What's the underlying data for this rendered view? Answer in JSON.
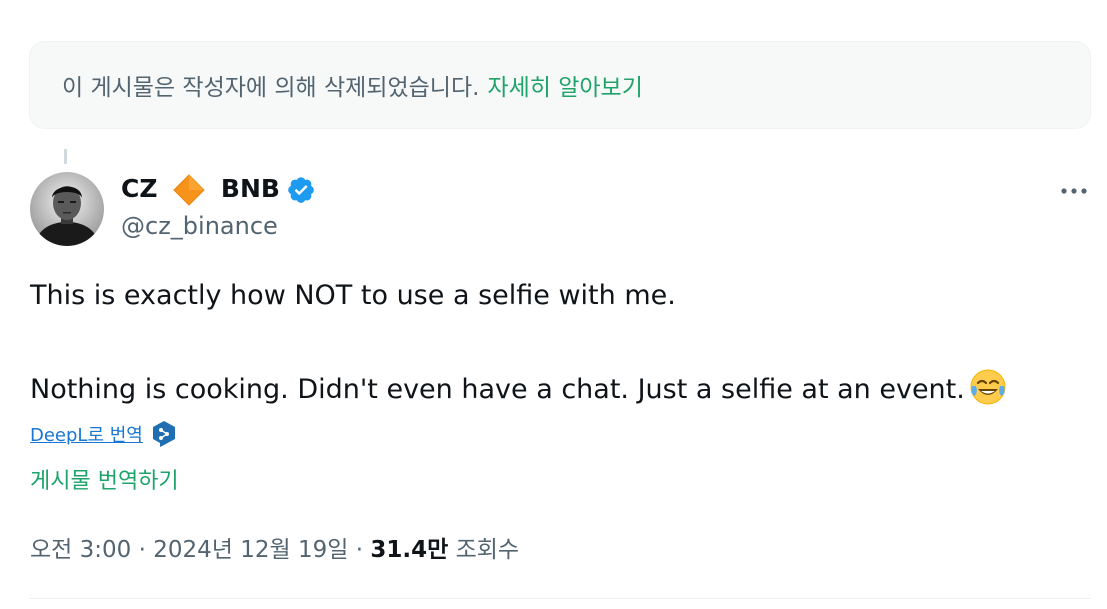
{
  "notice": {
    "text": "이 게시물은 작성자에 의해 삭제되었습니다.",
    "link": "자세히 알아보기"
  },
  "author": {
    "name_part1": "CZ",
    "name_part2": "BNB",
    "handle": "@cz_binance",
    "diamond_icon": "orange-diamond-icon",
    "verified_icon": "verified-badge-icon",
    "verified_color": "#1d9bf0",
    "diamond_color": "#f7931a"
  },
  "tweet": {
    "line1": "This is exactly how NOT to use a selfie with me.",
    "line2": "Nothing is cooking. Didn't even have a chat. Just a selfie at an event.",
    "emoji": "face-with-tears-of-joy-emoji"
  },
  "deepl": {
    "label": "DeepL로 번역",
    "icon": "deepl-icon"
  },
  "translate_link": "게시물 번역하기",
  "meta": {
    "time": "오전 3:00",
    "separator": "·",
    "date": "2024년 12월 19일",
    "views_count": "31.4만",
    "views_label": "조회수"
  },
  "colors": {
    "link_green": "#1fa36b",
    "secondary_text": "#536471",
    "primary_text": "#0f1419"
  }
}
